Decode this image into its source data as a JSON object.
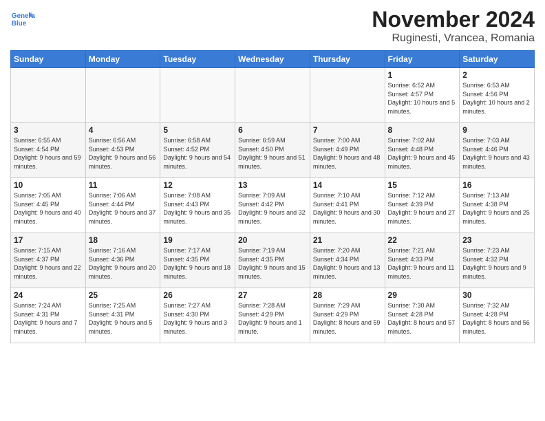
{
  "header": {
    "title": "November 2024",
    "location": "Ruginesti, Vrancea, Romania",
    "logo_general": "General",
    "logo_blue": "Blue"
  },
  "columns": [
    "Sunday",
    "Monday",
    "Tuesday",
    "Wednesday",
    "Thursday",
    "Friday",
    "Saturday"
  ],
  "weeks": [
    [
      {
        "day": "",
        "text": ""
      },
      {
        "day": "",
        "text": ""
      },
      {
        "day": "",
        "text": ""
      },
      {
        "day": "",
        "text": ""
      },
      {
        "day": "",
        "text": ""
      },
      {
        "day": "1",
        "text": "Sunrise: 6:52 AM\nSunset: 4:57 PM\nDaylight: 10 hours and 5 minutes."
      },
      {
        "day": "2",
        "text": "Sunrise: 6:53 AM\nSunset: 4:56 PM\nDaylight: 10 hours and 2 minutes."
      }
    ],
    [
      {
        "day": "3",
        "text": "Sunrise: 6:55 AM\nSunset: 4:54 PM\nDaylight: 9 hours and 59 minutes."
      },
      {
        "day": "4",
        "text": "Sunrise: 6:56 AM\nSunset: 4:53 PM\nDaylight: 9 hours and 56 minutes."
      },
      {
        "day": "5",
        "text": "Sunrise: 6:58 AM\nSunset: 4:52 PM\nDaylight: 9 hours and 54 minutes."
      },
      {
        "day": "6",
        "text": "Sunrise: 6:59 AM\nSunset: 4:50 PM\nDaylight: 9 hours and 51 minutes."
      },
      {
        "day": "7",
        "text": "Sunrise: 7:00 AM\nSunset: 4:49 PM\nDaylight: 9 hours and 48 minutes."
      },
      {
        "day": "8",
        "text": "Sunrise: 7:02 AM\nSunset: 4:48 PM\nDaylight: 9 hours and 45 minutes."
      },
      {
        "day": "9",
        "text": "Sunrise: 7:03 AM\nSunset: 4:46 PM\nDaylight: 9 hours and 43 minutes."
      }
    ],
    [
      {
        "day": "10",
        "text": "Sunrise: 7:05 AM\nSunset: 4:45 PM\nDaylight: 9 hours and 40 minutes."
      },
      {
        "day": "11",
        "text": "Sunrise: 7:06 AM\nSunset: 4:44 PM\nDaylight: 9 hours and 37 minutes."
      },
      {
        "day": "12",
        "text": "Sunrise: 7:08 AM\nSunset: 4:43 PM\nDaylight: 9 hours and 35 minutes."
      },
      {
        "day": "13",
        "text": "Sunrise: 7:09 AM\nSunset: 4:42 PM\nDaylight: 9 hours and 32 minutes."
      },
      {
        "day": "14",
        "text": "Sunrise: 7:10 AM\nSunset: 4:41 PM\nDaylight: 9 hours and 30 minutes."
      },
      {
        "day": "15",
        "text": "Sunrise: 7:12 AM\nSunset: 4:39 PM\nDaylight: 9 hours and 27 minutes."
      },
      {
        "day": "16",
        "text": "Sunrise: 7:13 AM\nSunset: 4:38 PM\nDaylight: 9 hours and 25 minutes."
      }
    ],
    [
      {
        "day": "17",
        "text": "Sunrise: 7:15 AM\nSunset: 4:37 PM\nDaylight: 9 hours and 22 minutes."
      },
      {
        "day": "18",
        "text": "Sunrise: 7:16 AM\nSunset: 4:36 PM\nDaylight: 9 hours and 20 minutes."
      },
      {
        "day": "19",
        "text": "Sunrise: 7:17 AM\nSunset: 4:35 PM\nDaylight: 9 hours and 18 minutes."
      },
      {
        "day": "20",
        "text": "Sunrise: 7:19 AM\nSunset: 4:35 PM\nDaylight: 9 hours and 15 minutes."
      },
      {
        "day": "21",
        "text": "Sunrise: 7:20 AM\nSunset: 4:34 PM\nDaylight: 9 hours and 13 minutes."
      },
      {
        "day": "22",
        "text": "Sunrise: 7:21 AM\nSunset: 4:33 PM\nDaylight: 9 hours and 11 minutes."
      },
      {
        "day": "23",
        "text": "Sunrise: 7:23 AM\nSunset: 4:32 PM\nDaylight: 9 hours and 9 minutes."
      }
    ],
    [
      {
        "day": "24",
        "text": "Sunrise: 7:24 AM\nSunset: 4:31 PM\nDaylight: 9 hours and 7 minutes."
      },
      {
        "day": "25",
        "text": "Sunrise: 7:25 AM\nSunset: 4:31 PM\nDaylight: 9 hours and 5 minutes."
      },
      {
        "day": "26",
        "text": "Sunrise: 7:27 AM\nSunset: 4:30 PM\nDaylight: 9 hours and 3 minutes."
      },
      {
        "day": "27",
        "text": "Sunrise: 7:28 AM\nSunset: 4:29 PM\nDaylight: 9 hours and 1 minute."
      },
      {
        "day": "28",
        "text": "Sunrise: 7:29 AM\nSunset: 4:29 PM\nDaylight: 8 hours and 59 minutes."
      },
      {
        "day": "29",
        "text": "Sunrise: 7:30 AM\nSunset: 4:28 PM\nDaylight: 8 hours and 57 minutes."
      },
      {
        "day": "30",
        "text": "Sunrise: 7:32 AM\nSunset: 4:28 PM\nDaylight: 8 hours and 56 minutes."
      }
    ]
  ]
}
